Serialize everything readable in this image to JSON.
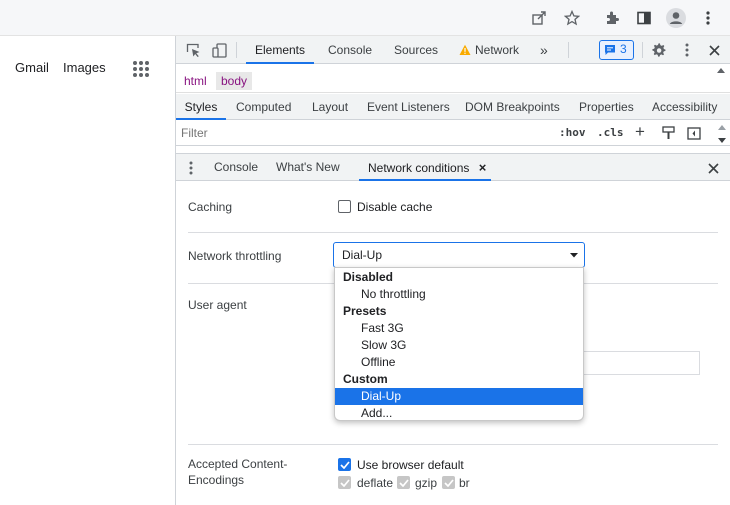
{
  "google_page": {
    "links": [
      "Gmail",
      "Images"
    ]
  },
  "chrome_toolbar": {
    "icons": [
      "share-icon",
      "star-icon",
      "extensions-icon",
      "side-panel-icon",
      "profile-icon",
      "more-vert-icon"
    ]
  },
  "devtools": {
    "main_tabs": {
      "elements": "Elements",
      "console": "Console",
      "sources": "Sources",
      "network": "Network",
      "more": "»"
    },
    "issues_count": "3",
    "breadcrumbs": [
      "html",
      "body"
    ],
    "styles_tabs": [
      "Styles",
      "Computed",
      "Layout",
      "Event Listeners",
      "DOM Breakpoints",
      "Properties",
      "Accessibility"
    ],
    "filter": {
      "placeholder": "Filter",
      "hov": ":hov",
      "cls": ".cls",
      "plus": "+"
    },
    "drawer_tabs": {
      "console": "Console",
      "whats_new": "What's New",
      "network_conditions": "Network conditions",
      "close_tab": "×"
    },
    "network_conditions": {
      "caching_label": "Caching",
      "disable_cache_label": "Disable cache",
      "throttling_label": "Network throttling",
      "throttling_value": "Dial-Up",
      "user_agent_label": "User agent",
      "encodings_label_line1": "Accepted Content-",
      "encodings_label_line2": "Encodings",
      "use_browser_default": "Use browser default",
      "encodings": [
        "deflate",
        "gzip",
        "br"
      ]
    },
    "throttle_dropdown": {
      "groups": [
        {
          "name": "Disabled",
          "items": [
            "No throttling"
          ]
        },
        {
          "name": "Presets",
          "items": [
            "Fast 3G",
            "Slow 3G",
            "Offline"
          ]
        },
        {
          "name": "Custom",
          "items": [
            "Dial-Up",
            "Add..."
          ]
        }
      ],
      "selected": "Dial-Up"
    }
  },
  "colors": {
    "accent": "#1a73e8",
    "warning": "#f9ab00",
    "breadcrumb_tag": "#881280"
  }
}
